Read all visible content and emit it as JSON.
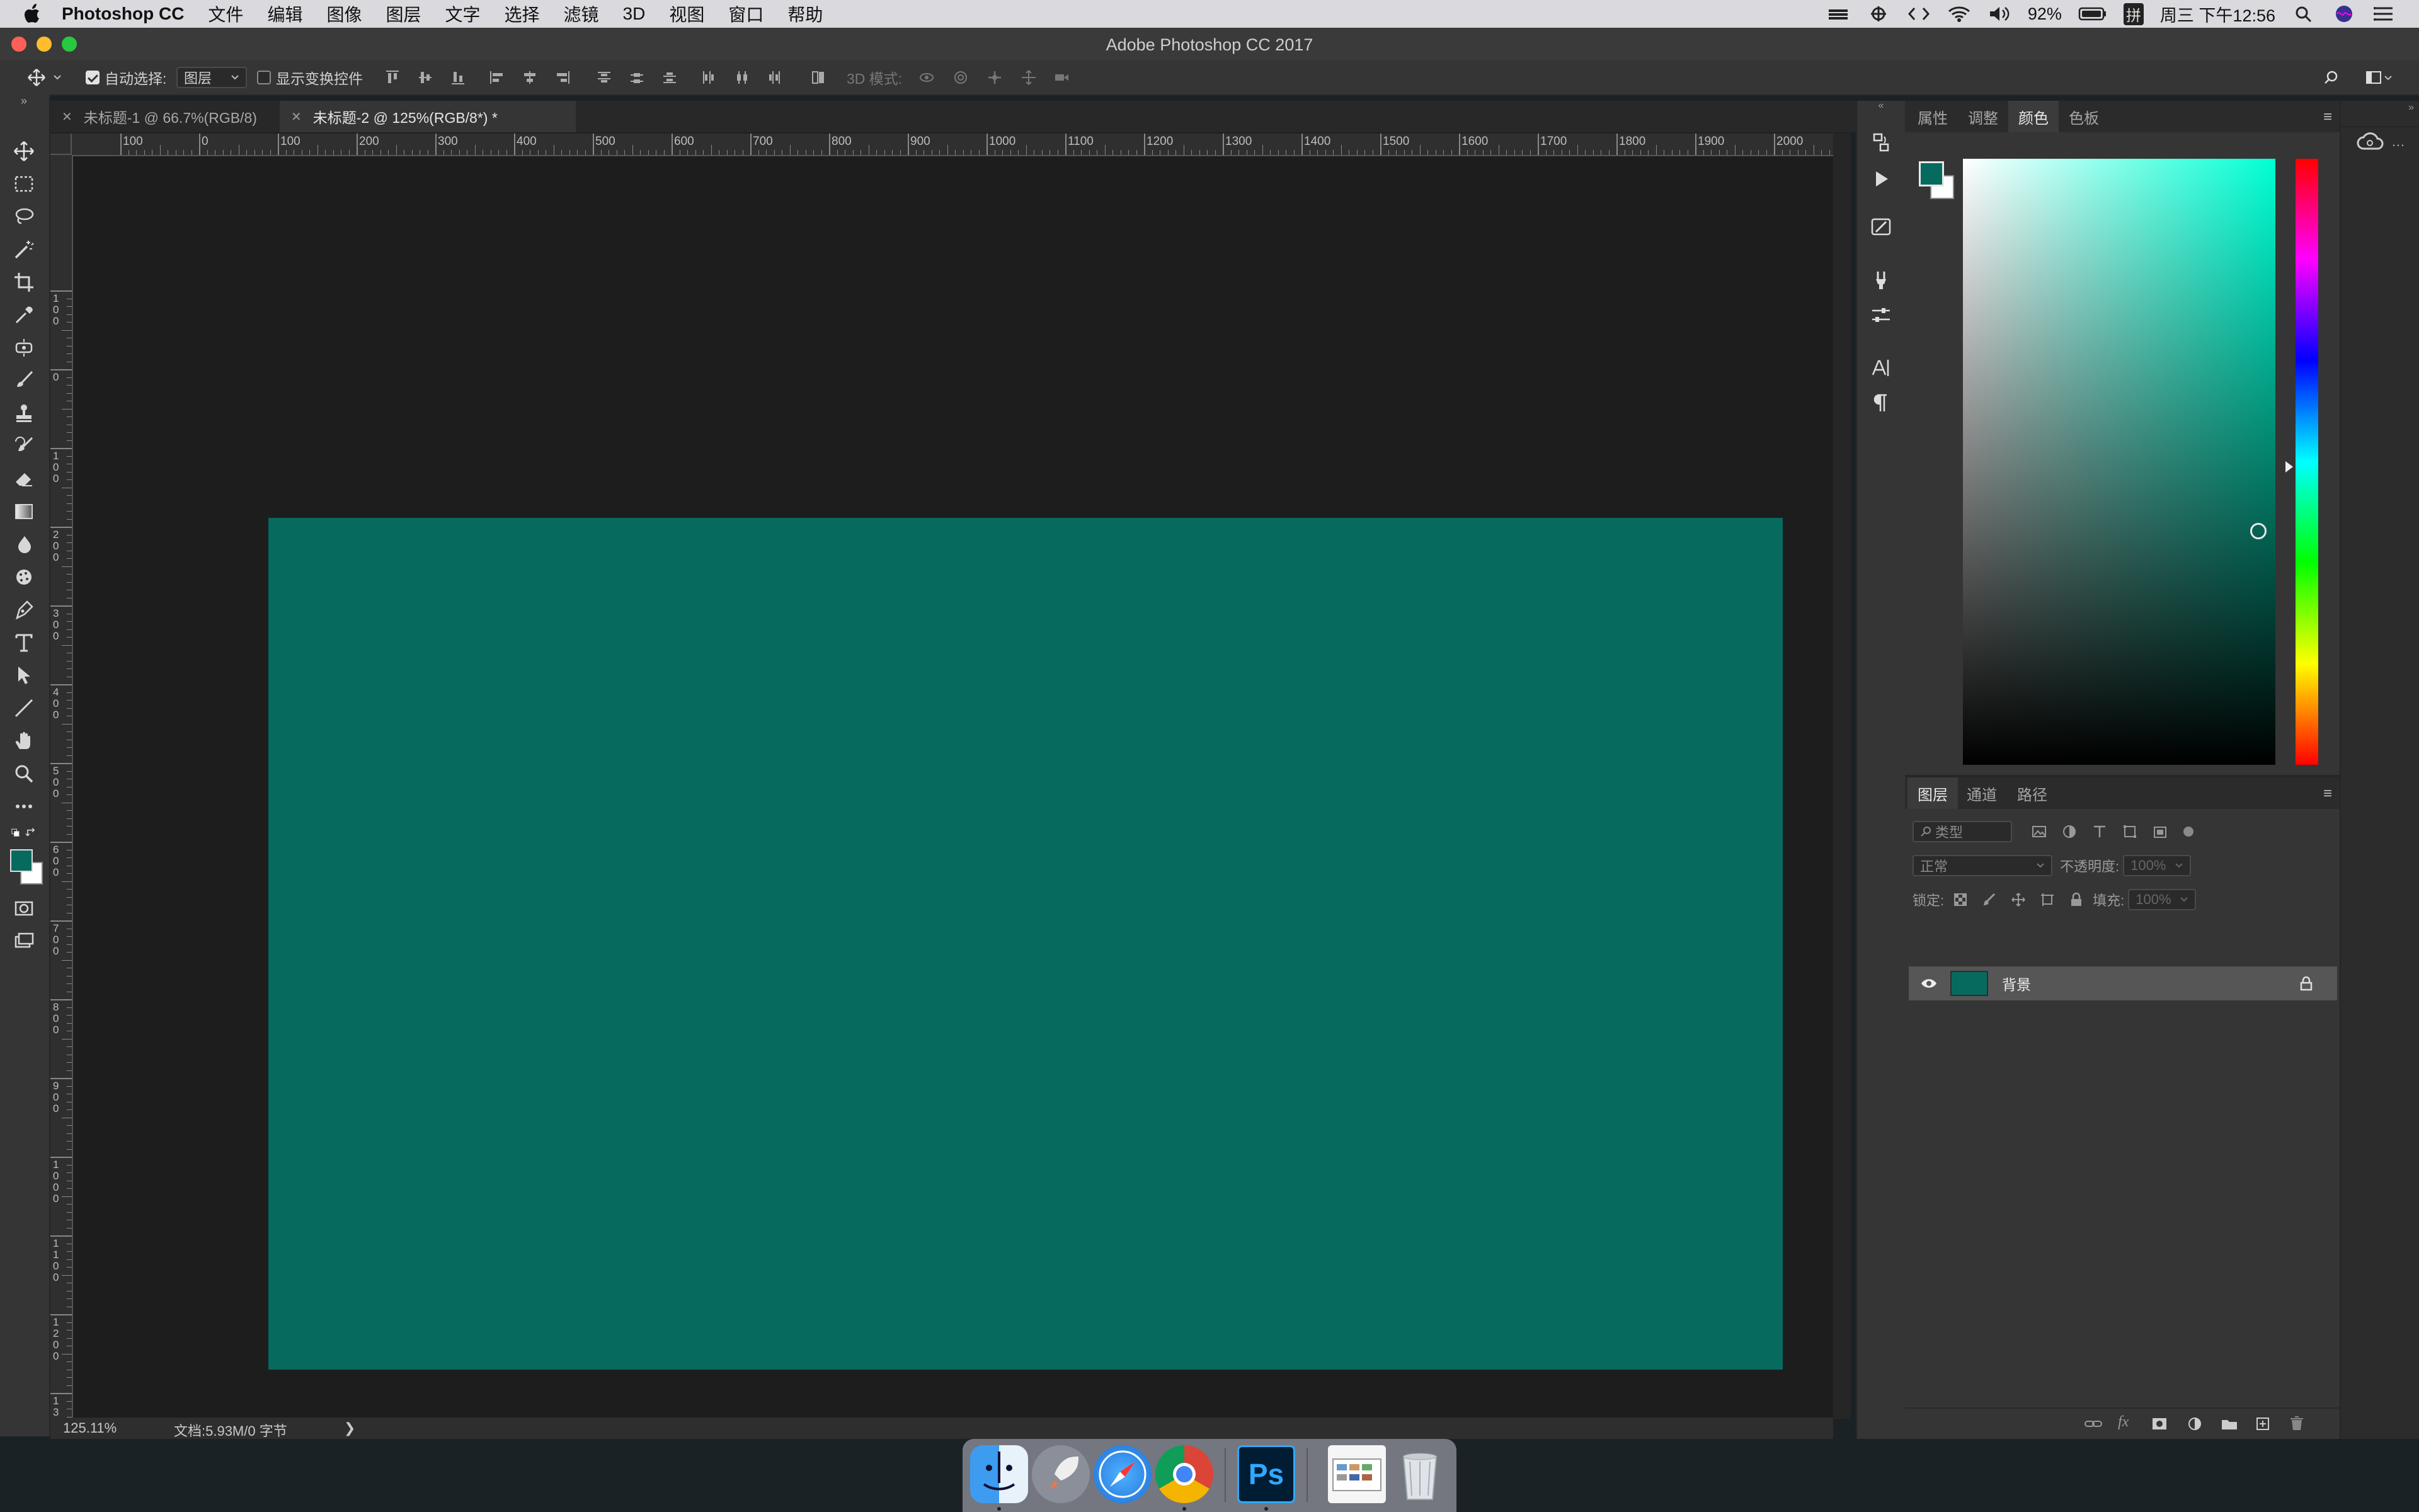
{
  "menubar": {
    "app_name": "Photoshop CC",
    "items": [
      "文件",
      "编辑",
      "图像",
      "图层",
      "文字",
      "选择",
      "滤镜",
      "3D",
      "视图",
      "窗口",
      "帮助"
    ],
    "battery": "92%",
    "input_method": "拼",
    "clock": "周三 下午12:56"
  },
  "window": {
    "title": "Adobe Photoshop CC 2017"
  },
  "options_bar": {
    "auto_select_label": "自动选择:",
    "auto_select_value": "图层",
    "show_transform_label": "显示变换控件",
    "mode_3d_label": "3D 模式:"
  },
  "tabs": [
    {
      "label": "未标题-1 @ 66.7%(RGB/8)",
      "active": false
    },
    {
      "label": "未标题-2 @ 125%(RGB/8*) *",
      "active": true
    }
  ],
  "ruler_top_labels": [
    "100",
    "0",
    "100",
    "200",
    "300",
    "400",
    "500",
    "600",
    "700",
    "800",
    "900",
    "1000",
    "1100",
    "1200",
    "1300",
    "1400",
    "1500",
    "1600",
    "1700",
    "1800",
    "1900",
    "2000"
  ],
  "ruler_left_labels": [
    "100",
    "0",
    "100",
    "200",
    "300",
    "400",
    "500",
    "600",
    "700",
    "800",
    "900",
    "1000",
    "1100",
    "1200",
    "1300"
  ],
  "canvas": {
    "fill_color": "#076a5f",
    "background": "#1d1d1d"
  },
  "status": {
    "zoom": "125.11%",
    "doc_info": "文档:5.93M/0 字节",
    "arrow": "❯"
  },
  "color_panel": {
    "tabs": [
      "属性",
      "调整",
      "颜色",
      "色板"
    ],
    "active_tab": "颜色",
    "foreground": "#076a5f",
    "background": "#ffffff"
  },
  "layers_panel": {
    "tabs": [
      "图层",
      "通道",
      "路径"
    ],
    "active_tab": "图层",
    "filter_placeholder": "类型",
    "blend_mode": "正常",
    "opacity_label": "不透明度:",
    "opacity_value": "100%",
    "lock_label": "锁定:",
    "fill_label": "填充:",
    "fill_value": "100%",
    "layers": [
      {
        "name": "背景",
        "visible": true,
        "locked": true,
        "color": "#076a5f"
      }
    ]
  },
  "dock_apps": [
    "finder",
    "launchpad",
    "safari",
    "chrome",
    "photoshop",
    "photos",
    "trash"
  ],
  "photoshop_icon_text": "Ps"
}
